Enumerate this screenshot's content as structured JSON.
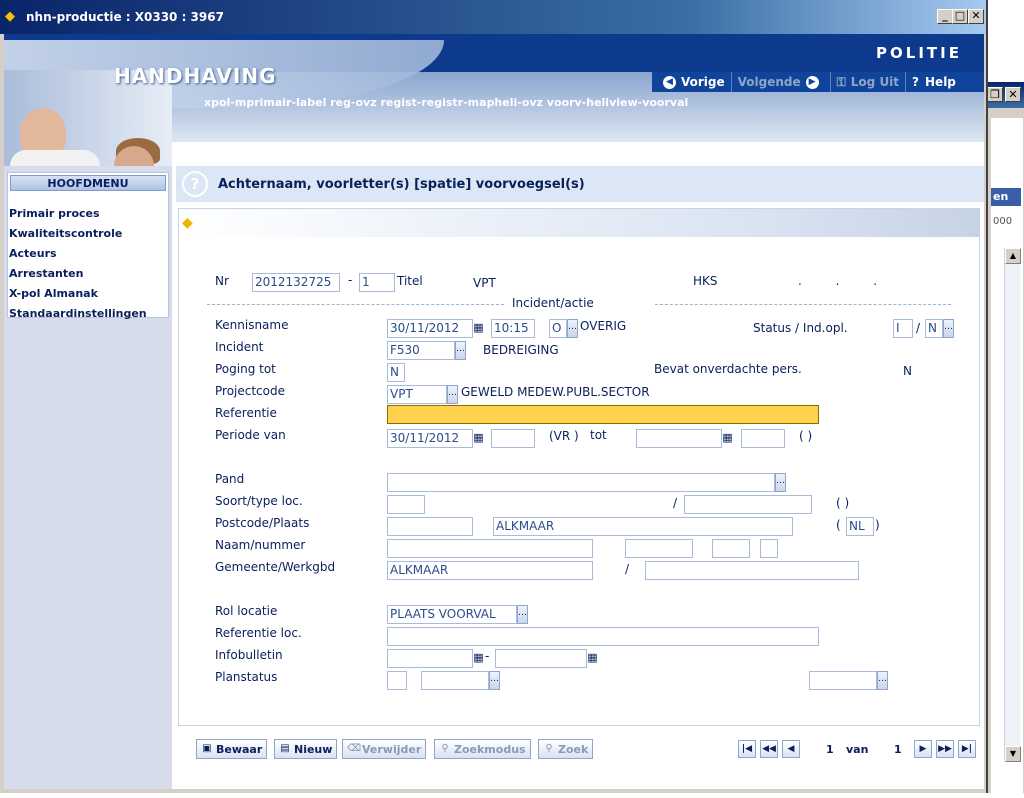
{
  "window": {
    "title": "nhn-productie : X0330 : 3967"
  },
  "header": {
    "logo": "POLITIE",
    "app_title": "HANDHAVING",
    "breadcrumb": "xpol-mprimair-label  reg-ovz  regist-registr-mapheli-ovz  voorv-heliview-voorval",
    "nav": {
      "vorige": "Vorige",
      "volgende": "Volgende",
      "logout": "Log Uit",
      "help": "Help"
    }
  },
  "background_window": {
    "tab_label": "en",
    "text": "000"
  },
  "sidebar": {
    "menu_title": "HOOFDMENU",
    "items": [
      "Primair proces",
      "Kwaliteitscontrole",
      "Acteurs",
      "Arrestanten",
      "X-pol Almanak",
      "Standaardinstellingen"
    ]
  },
  "question": "Achternaam, voorletter(s) [spatie] voorvoegsel(s)",
  "form": {
    "nr_label": "Nr",
    "nr_value": "2012132725",
    "nr_dash": "-",
    "nr_sub": "1",
    "titel_label": "Titel",
    "titel_value": "VPT",
    "hks_label": "HKS",
    "hks_dots": ".     .     .",
    "section_title": "Incident/actie",
    "kennisname_label": "Kennisname",
    "kennisname_date": "30/11/2012",
    "kennisname_time": "10:15",
    "kennisname_code": "O",
    "kennisname_desc": "OVERIG",
    "status_label": "Status / Ind.opl.",
    "status_value": "I",
    "status_slash": "/",
    "indopl_value": "N",
    "incident_label": "Incident",
    "incident_code": "F530",
    "incident_desc": "BEDREIGING",
    "poging_label": "Poging tot",
    "poging_value": "N",
    "bevat_label": "Bevat onverdachte pers.",
    "bevat_value": "N",
    "project_label": "Projectcode",
    "project_code": "VPT",
    "project_desc": "GEWELD MEDEW.PUBL.SECTOR",
    "referentie_label": "Referentie",
    "referentie_value": "",
    "periode_label": "Periode van",
    "periode_date": "30/11/2012",
    "periode_vr": "(VR )",
    "periode_tot": "tot",
    "periode_paren": "(     )",
    "pand_label": "Pand",
    "soort_label": "Soort/type loc.",
    "soort_slash": "/",
    "soort_paren": "(     )",
    "postcode_label": "Postcode/Plaats",
    "plaats_value": "ALKMAAR",
    "land_open": "(",
    "land_value": "NL",
    "land_close": ")",
    "naam_label": "Naam/nummer",
    "gemeente_label": "Gemeente/Werkgbd",
    "gemeente_value": "ALKMAAR",
    "gemeente_slash": "/",
    "rol_label": "Rol locatie",
    "rol_value": "PLAATS VOORVAL",
    "refloc_label": "Referentie loc.",
    "infobulletin_label": "Infobulletin",
    "infobulletin_dash": "-",
    "planstatus_label": "Planstatus"
  },
  "actions": {
    "bewaar": "Bewaar",
    "nieuw": "Nieuw",
    "verwijder": "Verwijder",
    "zoekmodus": "Zoekmodus",
    "zoek": "Zoek"
  },
  "pager": {
    "current": "1",
    "van": "van",
    "total": "1"
  },
  "colors": {
    "header_blue": "#0d3a8c",
    "highlight": "#ffd24d",
    "text": "#0a1f5c"
  }
}
